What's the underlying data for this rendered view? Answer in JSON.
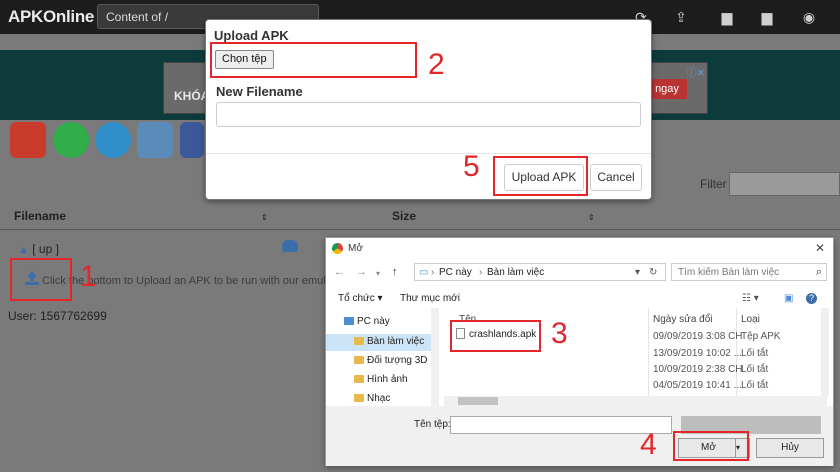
{
  "app": {
    "title": "APKOnline"
  },
  "topbar": {
    "path_label": "Content of /"
  },
  "ad": {
    "headline": "KHÓA",
    "cta": "ngay"
  },
  "filter": {
    "label": "Filter"
  },
  "table": {
    "columns": [
      "Filename",
      "Size"
    ],
    "up_label": "[ up ]",
    "upload_text": "Click the bottom to Upload an APK to be run with our emulator"
  },
  "user": {
    "label": "User: 1567762699"
  },
  "upload_modal": {
    "title": "Upload APK",
    "choose_file": "Chọn tệp",
    "filename_label": "New Filename",
    "upload_button": "Upload APK",
    "cancel_button": "Cancel"
  },
  "file_dialog": {
    "title": "Mở",
    "breadcrumb": [
      "PC này",
      "Bàn làm việc"
    ],
    "search_placeholder": "Tìm kiếm Bàn làm việc",
    "toolbar": {
      "organize": "Tổ chức ▾",
      "new_folder": "Thư mục mới"
    },
    "tree": [
      "PC này",
      "Bàn làm việc",
      "Đối tượng 3D",
      "Hình ảnh",
      "Nhạc"
    ],
    "columns": {
      "name": "Tên",
      "date": "Ngày sửa đổi",
      "type": "Loại"
    },
    "rows": [
      {
        "name": "crashlands.apk",
        "date": "09/09/2019 3:08 CH",
        "type": "Tệp APK"
      },
      {
        "name": "",
        "date": "13/09/2019 10:02 ...",
        "type": "Lối tắt"
      },
      {
        "name": "",
        "date": "10/09/2019 2:38 CH",
        "type": "Lối tắt"
      },
      {
        "name": "",
        "date": "04/05/2019 10:41 ...",
        "type": "Lối tắt"
      }
    ],
    "filename_label": "Tên tệp:",
    "open_button": "Mở",
    "cancel_button": "Hủy"
  },
  "annotations": [
    "1",
    "2",
    "3",
    "4",
    "5"
  ],
  "colors": {
    "annotation": "#e2262a",
    "topbar": "#1d1d1d",
    "ad_band": "#0d3b3c"
  }
}
